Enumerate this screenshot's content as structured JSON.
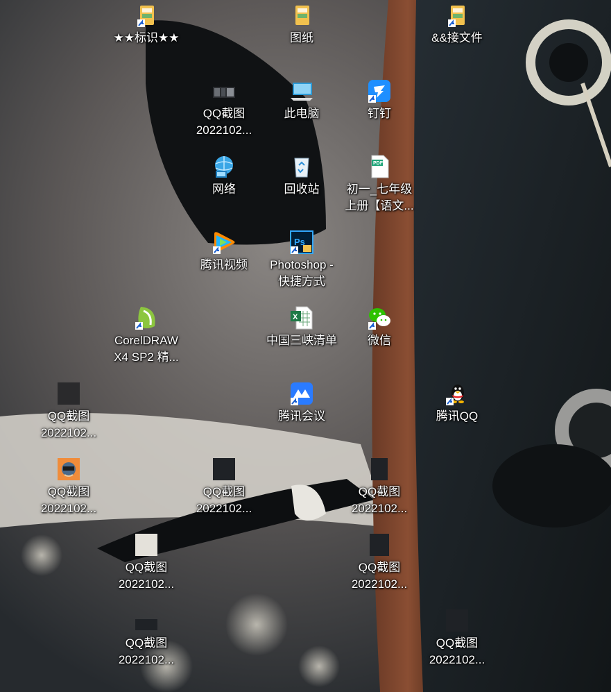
{
  "desktop": {
    "icons": [
      {
        "label": "★★标识★★",
        "icon": "folder-shortcut-icon"
      },
      {
        "label": "图纸",
        "icon": "folder-icon"
      },
      {
        "label": "&&接文件",
        "icon": "folder-shortcut-icon"
      },
      {
        "label": "QQ截图\n2022102...",
        "icon": "image-thumbnail-icon"
      },
      {
        "label": "此电脑",
        "icon": "computer-icon"
      },
      {
        "label": "钉钉",
        "icon": "dingtalk-icon"
      },
      {
        "label": "网络",
        "icon": "network-icon"
      },
      {
        "label": "回收站",
        "icon": "recycle-bin-icon"
      },
      {
        "label": "初一_七年级\n上册【语文...",
        "icon": "pdf-file-icon"
      },
      {
        "label": "腾讯视频",
        "icon": "tencent-video-icon"
      },
      {
        "label": "Photoshop -\n快捷方式",
        "icon": "photoshop-icon"
      },
      {
        "label": "CorelDRAW\nX4 SP2 精...",
        "icon": "coreldraw-icon"
      },
      {
        "label": "中国三峡清单",
        "icon": "excel-file-icon"
      },
      {
        "label": "微信",
        "icon": "wechat-icon"
      },
      {
        "label": "QQ截图\n2022102...",
        "icon": "image-thumbnail-icon"
      },
      {
        "label": "腾讯会议",
        "icon": "tencent-meeting-icon"
      },
      {
        "label": "腾讯QQ",
        "icon": "qq-penguin-icon"
      },
      {
        "label": "QQ截图\n2022102...",
        "icon": "image-thumbnail-icon"
      },
      {
        "label": "QQ截图\n2022102...",
        "icon": "image-thumbnail-icon"
      },
      {
        "label": "QQ截图\n2022102...",
        "icon": "image-thumbnail-icon"
      },
      {
        "label": "QQ截图\n2022102...",
        "icon": "image-thumbnail-icon"
      },
      {
        "label": "QQ截图\n2022102...",
        "icon": "image-thumbnail-icon"
      },
      {
        "label": "QQ截图\n2022102...",
        "icon": "image-thumbnail-icon"
      },
      {
        "label": "QQ截图\n2022102...",
        "icon": "image-thumbnail-icon"
      }
    ]
  },
  "colors": {
    "label_text": "#ffffff",
    "folder": "#f2c14e",
    "dingtalk": "#1e8fff",
    "excel": "#1f7a46",
    "photoshop": "#001e36",
    "wechat": "#2dc100",
    "tencent_video": "#1fb7ff",
    "tencent_meeting": "#2a7bff"
  }
}
